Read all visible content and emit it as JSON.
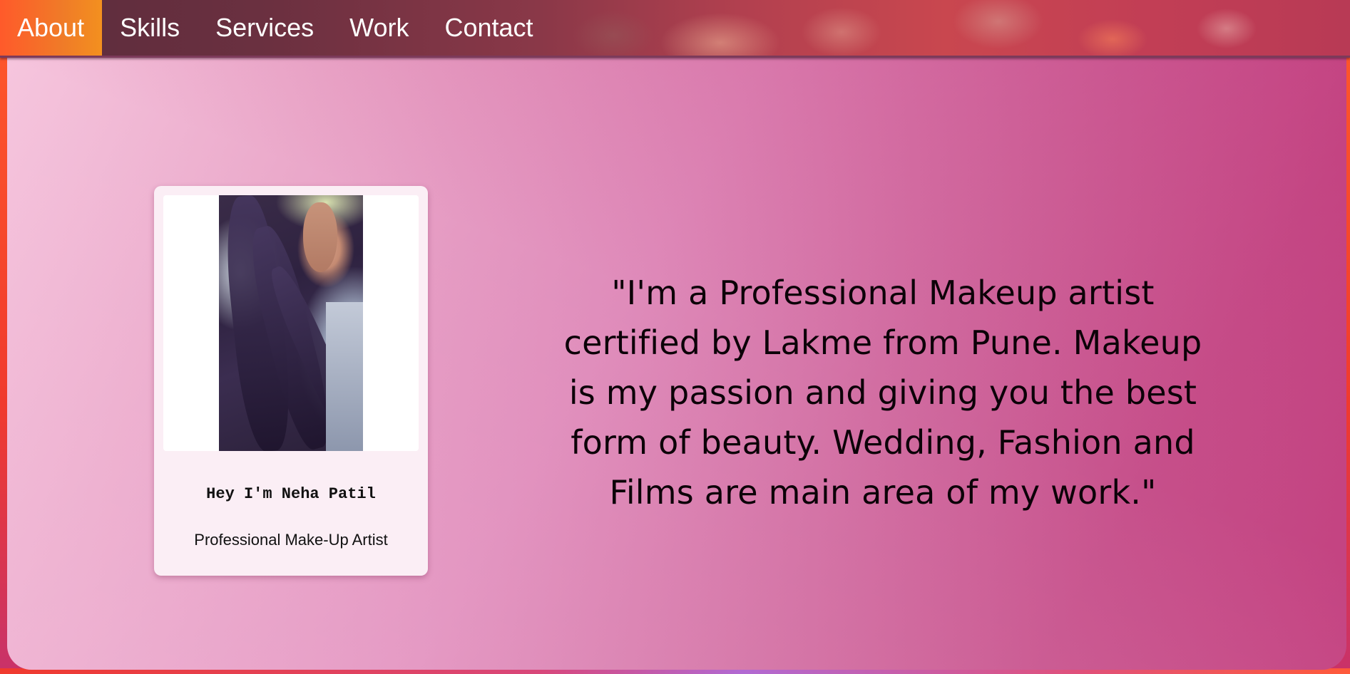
{
  "nav": {
    "items": [
      {
        "label": "About",
        "active": true
      },
      {
        "label": "Skills",
        "active": false
      },
      {
        "label": "Services",
        "active": false
      },
      {
        "label": "Work",
        "active": false
      },
      {
        "label": "Contact",
        "active": false
      }
    ]
  },
  "profile": {
    "name": "Hey I'm Neha Patil",
    "role": "Professional Make-Up Artist",
    "photo": "profile-photo"
  },
  "about": {
    "quote": "\"I'm a Professional Makeup artist certified by Lakme from Pune. Makeup is my passion and giving you the best form of beauty. Wedding, Fashion and Films are main area of my work.\""
  },
  "colors": {
    "nav_active": "#f3901f",
    "panel_start": "#f6c6de",
    "panel_end": "#c3407f",
    "card_bg": "#fbeef5"
  }
}
